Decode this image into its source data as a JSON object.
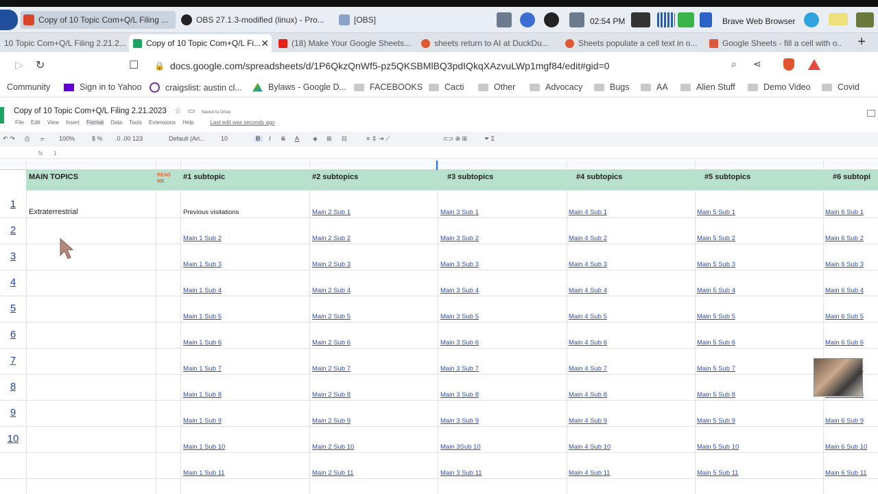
{
  "taskbar": {
    "tasks": [
      {
        "label": "Copy of 10 Topic Com+Q/L Filing ..."
      },
      {
        "label": "OBS 27.1.3-modified (linux) - Pro..."
      },
      {
        "label": "[OBS]"
      }
    ],
    "clock": "02:54 PM",
    "browser_label": "Brave Web Browser"
  },
  "tabs": [
    {
      "label": "10 Topic Com+Q/L Filing 2.21.2..."
    },
    {
      "label": "Copy of 10 Topic Com+Q/L Fi..."
    },
    {
      "label": "(18) Make Your Google Sheets..."
    },
    {
      "label": "sheets return to AI at DuckDu..."
    },
    {
      "label": "Sheets populate a cell text in o..."
    },
    {
      "label": "Google Sheets - fill a cell with o..."
    }
  ],
  "url": "docs.google.com/spreadsheets/d/1P6QkzQnWf5-pz5QKSBMlBQ3pdIQkqXAzvuLWp1mgf84/edit#gid=0",
  "bookmarks": [
    "Community",
    "Sign in to Yahoo",
    "craigslist: austin cl...",
    "Bylaws - Google D...",
    "FACEBOOKS",
    "Cacti",
    "Other",
    "Advocacy",
    "Bugs",
    "AA",
    "Alien Stuff",
    "Demo Video",
    "Covid"
  ],
  "doc": {
    "title": "Copy of 10 Topic Com+Q/L Filing  2.21.2023",
    "saved": "Saved to Drive",
    "menus": [
      "File",
      "Edit",
      "View",
      "Insert",
      "Format",
      "Data",
      "Tools",
      "Extensions",
      "Help"
    ],
    "last_edit": "Last edit was seconds ago"
  },
  "toolbar": {
    "zoom": "100%",
    "font": "Default (Ari...",
    "size": "10"
  },
  "formula": {
    "cell_ref": "",
    "value": "1"
  },
  "headers": {
    "main": "MAIN TOPICS",
    "readme": "READ ME",
    "subs": [
      "#1  subtopic",
      "#2  subtopics",
      "#3  subtopics",
      "#4  subtopics",
      "#5  subtopics",
      "#6  subtopi"
    ]
  },
  "rows": [
    {
      "num": "1",
      "main": "Extraterrestrial",
      "cells": [
        "Previous visitations",
        "Main 2 Sub 1",
        "Main 3 Sub 1",
        "Main 4 Sub 1",
        "Main 5 Sub 1",
        "Main 6 Sub 1"
      ]
    },
    {
      "num": "2",
      "main": "",
      "cells": [
        "Main 1 Sub 2",
        "Main 2 Sub 2",
        "Main 3 Sub 2",
        "Main 4 Sub 2",
        "Main 5 Sub 2",
        "Main 6 Sub 2"
      ]
    },
    {
      "num": "3",
      "main": "",
      "cells": [
        "Main 1 Sub 3",
        "Main 2 Sub 3",
        "Main 3 Sub 3",
        "Main 4 Sub 3",
        "Main 5 Sub 3",
        "Main 6 Sub 3"
      ]
    },
    {
      "num": "4",
      "main": "",
      "cells": [
        "Main 1 Sub 4",
        "Main 2 Sub 4",
        "Main 3 Sub 4",
        "Main 4 Sub 4",
        "Main 5 Sub 4",
        "Main 6 Sub 4"
      ]
    },
    {
      "num": "5",
      "main": "",
      "cells": [
        "Main 1 Sub 5",
        "Main 2 Sub 5",
        "Main 3 Sub 5",
        "Main 4 Sub 5",
        "Main 5 Sub 5",
        "Main 6 Sub 5"
      ]
    },
    {
      "num": "6",
      "main": "",
      "cells": [
        "Main 1 Sub 6",
        "Main 2 Sub 6",
        "Main 3 Sub 6",
        "Main 4 Sub 6",
        "Main 5 Sub 6",
        "Main 6 Sub 6"
      ]
    },
    {
      "num": "7",
      "main": "",
      "cells": [
        "Main 1 Sub 7",
        "Main 2 Sub 7",
        "Main 3 Sub 7",
        "Main 4 Sub 7",
        "Main 5 Sub 7",
        "Main 6 Sub 7"
      ]
    },
    {
      "num": "8",
      "main": "",
      "cells": [
        "Main 1 Sub 8",
        "Main 2 Sub 8",
        "Main 3 Sub 8",
        "Main 4 Sub 8",
        "Main 5 Sub 8",
        "Main 6 Sub 8"
      ]
    },
    {
      "num": "9",
      "main": "",
      "cells": [
        "Main 1 Sub 9",
        "Main 2 Sub 9",
        "Main 3 Sub 9",
        "Main 4 Sub 9",
        "Main 5 Sub 9",
        "Main 6 Sub 9"
      ]
    },
    {
      "num": "10",
      "main": "",
      "cells": [
        "Main 1 Sub 10",
        "Main 2 Sub 10",
        "Main 3Sub 10",
        "Main 4 Sub 10",
        "Main 5 Sub 10",
        "Main 6 Sub 10"
      ]
    },
    {
      "num": "",
      "main": "",
      "cells": [
        "Main 1 Sub 11",
        "Main 2 Sub 11",
        "Main 3 Sub 11",
        "Main 4 Sub 11",
        "Main 5 Sub 11",
        "Main 6 Sub 11"
      ]
    }
  ]
}
